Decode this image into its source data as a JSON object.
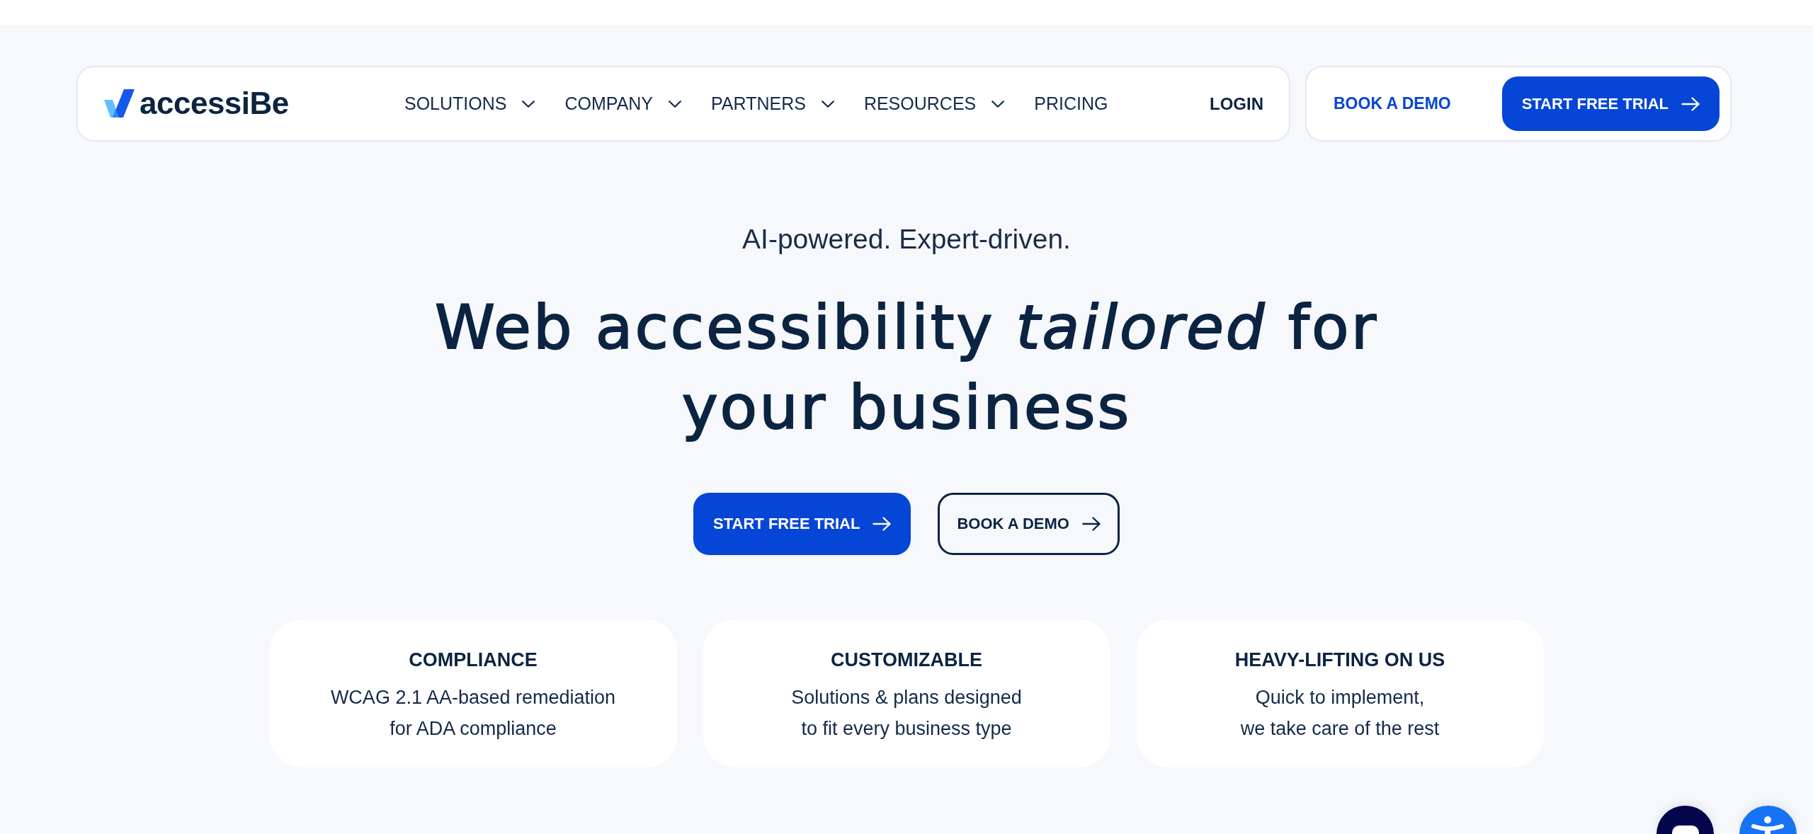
{
  "nav": {
    "logo": "accessiBe",
    "menu": [
      {
        "label": "SOLUTIONS",
        "dropdown": true
      },
      {
        "label": "COMPANY",
        "dropdown": true
      },
      {
        "label": "PARTNERS",
        "dropdown": true
      },
      {
        "label": "RESOURCES",
        "dropdown": true
      },
      {
        "label": "PRICING",
        "dropdown": false
      }
    ],
    "login": "LOGIN",
    "actions": [
      {
        "label": "BOOK A DEMO",
        "kind": "link"
      },
      {
        "label": "START FREE TRIAL",
        "kind": "primary"
      }
    ]
  },
  "hero": {
    "tagline": "AI-powered. Expert-driven.",
    "heading": "Web accessibility *tailored* for your business",
    "buttons": [
      {
        "label": "START FREE TRIAL",
        "kind": "primary"
      },
      {
        "label": "BOOK A DEMO",
        "kind": "outline"
      }
    ]
  },
  "features": [
    {
      "title": "COMPLIANCE",
      "text": "WCAG 2.1 AA-based remediation\nfor ADA compliance"
    },
    {
      "title": "CUSTOMIZABLE",
      "text": "Solutions & plans designed\nto fit every business type"
    },
    {
      "title": "HEAVY-LIFTING ON US",
      "text": "Quick to implement,\nwe take care of the rest"
    }
  ],
  "floating_buttons": [
    {
      "kind": "chat"
    },
    {
      "kind": "accessibility"
    }
  ]
}
